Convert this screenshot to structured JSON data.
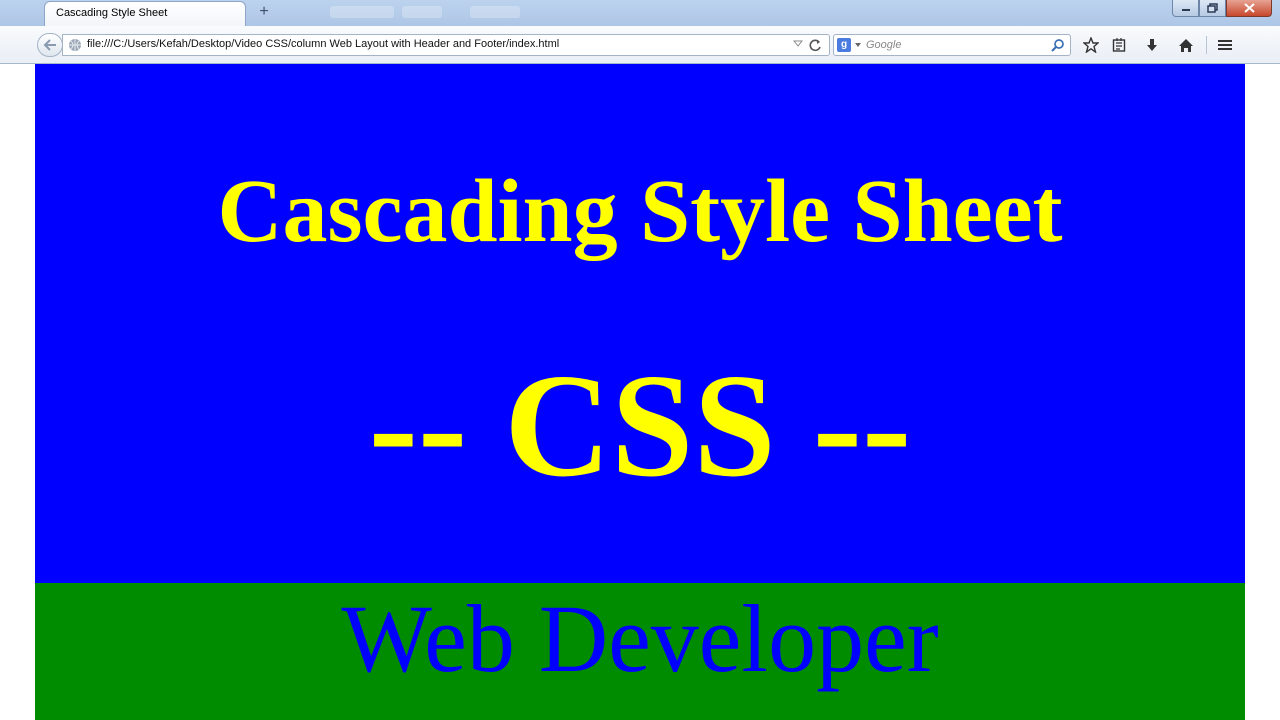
{
  "browser": {
    "tab_title": "Cascading Style Sheet",
    "new_tab_symbol": "+",
    "url": "file:///C:/Users/Kefah/Desktop/Video CSS/column Web Layout with Header and Footer/index.html",
    "search_placeholder": "Google",
    "search_engine_badge": "g",
    "icons": [
      "back-arrow-icon",
      "globe-icon",
      "url-dropdown-icon",
      "reload-icon",
      "google-icon",
      "search-icon",
      "star-icon",
      "reading-list-icon",
      "download-icon",
      "home-icon",
      "menu-icon",
      "minimize-icon",
      "restore-icon",
      "close-icon"
    ]
  },
  "page": {
    "header": {
      "title": "Cascading Style Sheet",
      "subtitle": "-- CSS --",
      "background_color": "#0000ff",
      "text_color": "#ffff00"
    },
    "footer": {
      "text": "Web Developer",
      "background_color": "#008c00",
      "text_color": "#0000ff"
    }
  }
}
